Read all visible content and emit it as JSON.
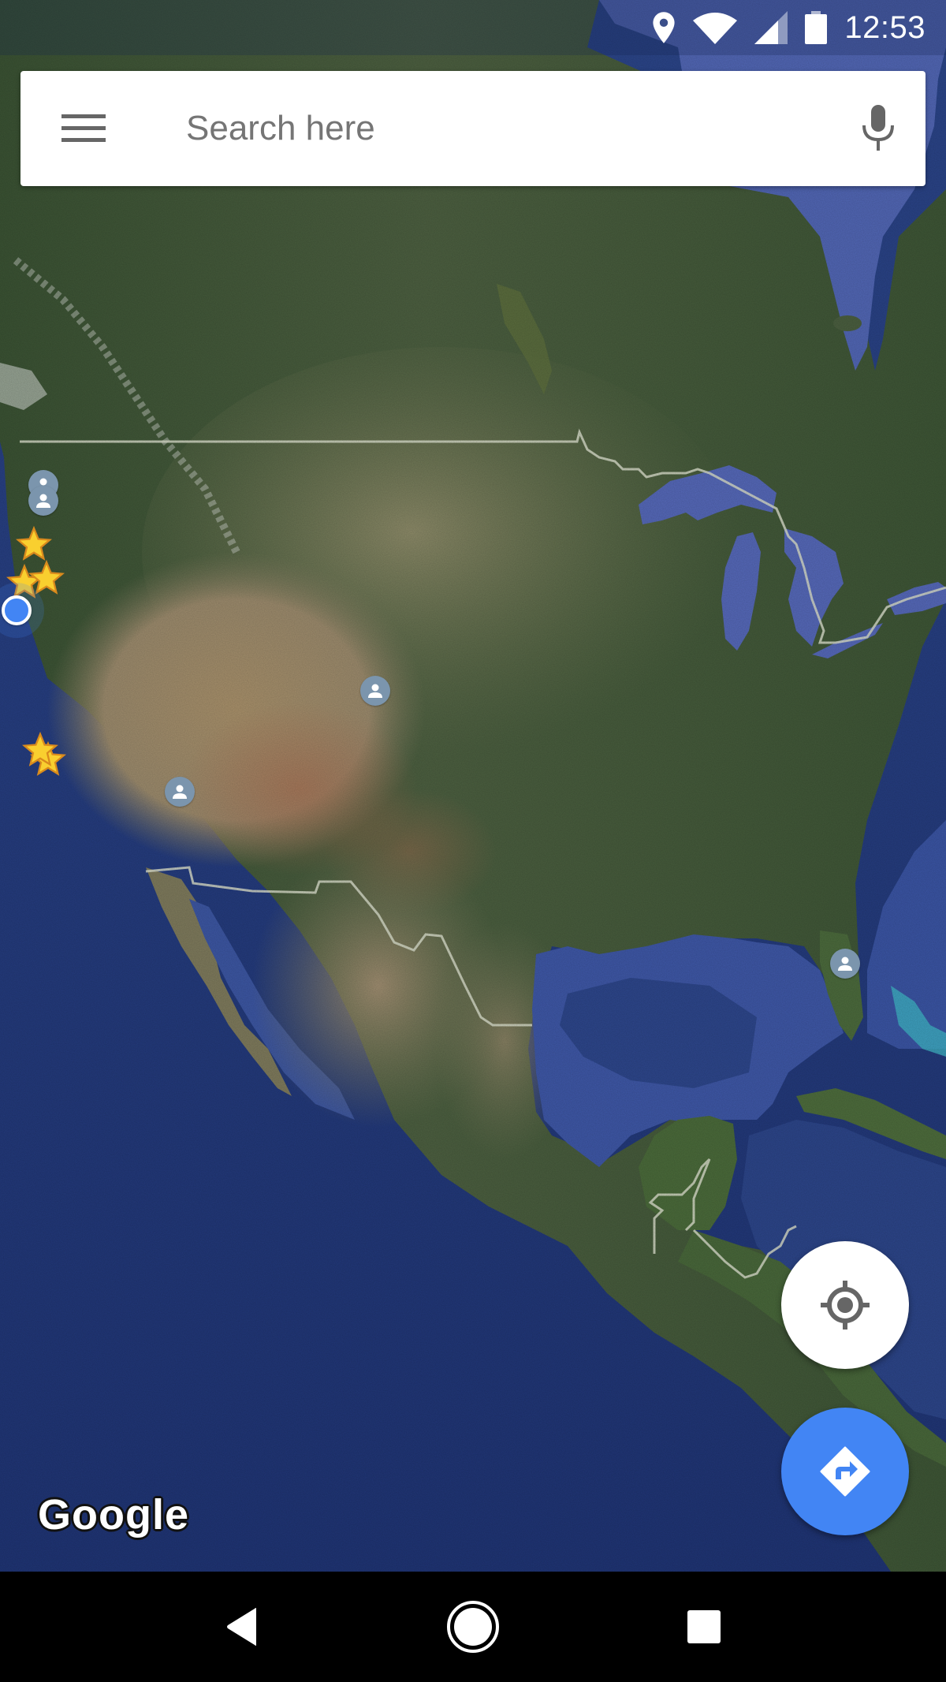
{
  "status_bar": {
    "time": "12:53",
    "icons": [
      "location-pin-icon",
      "wifi-icon",
      "cell-signal-icon",
      "battery-icon"
    ]
  },
  "search": {
    "placeholder": "Search here",
    "value": "",
    "menu_icon": "hamburger-menu-icon",
    "mic_icon": "microphone-icon"
  },
  "map": {
    "type": "satellite",
    "region": "North America",
    "attribution": "Google",
    "colors": {
      "ocean_deep": "#233a7e",
      "ocean_shallow": "#4e66b0",
      "land_green": "#3f5a34",
      "land_desert": "#9a8a6a",
      "border": "#d8dccb",
      "accent": "#4285f4",
      "star": "#f9cf2f",
      "person_marker": "#7b95ad"
    },
    "markers": {
      "starred_places": [
        {
          "name": "starred-place"
        },
        {
          "name": "starred-place"
        },
        {
          "name": "starred-place"
        },
        {
          "name": "starred-place"
        },
        {
          "name": "starred-place"
        }
      ],
      "contacts": [
        {
          "name": "contact-location"
        },
        {
          "name": "contact-location"
        },
        {
          "name": "contact-location"
        },
        {
          "name": "contact-location"
        },
        {
          "name": "contact-location"
        }
      ],
      "my_location": {
        "name": "current-location"
      }
    }
  },
  "fabs": {
    "my_location": {
      "icon": "gps-crosshair-icon",
      "color": "#ffffff"
    },
    "directions": {
      "icon": "directions-icon",
      "color": "#4285f4"
    }
  },
  "nav_bar": {
    "back_icon": "back-triangle-icon",
    "home_icon": "home-circle-icon",
    "recents_icon": "recents-square-icon"
  }
}
